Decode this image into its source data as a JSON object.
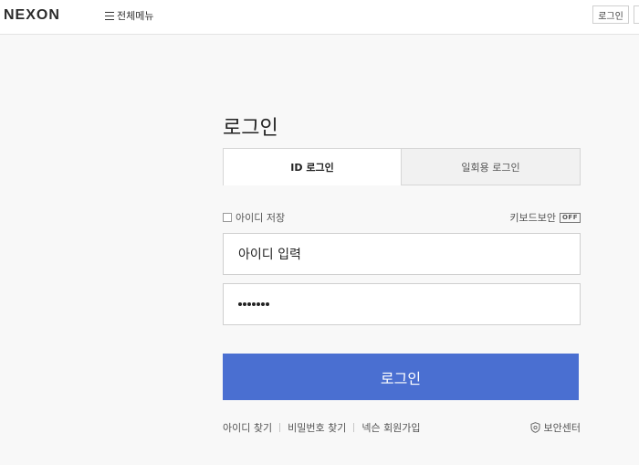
{
  "header": {
    "logo": "NEXON",
    "menu_label": "전체메뉴",
    "login_label": "로그인"
  },
  "login": {
    "title": "로그인",
    "tabs": [
      {
        "label": "ID 로그인",
        "active": true
      },
      {
        "label": "일회용 로그인",
        "active": false
      }
    ],
    "remember_label": "아이디 저장",
    "keyboard_label": "키보드보안",
    "keyboard_state": "OFF",
    "id_value": "아이디 입력",
    "password_length": 7,
    "submit_label": "로그인",
    "accent_color": "#4a6fd1"
  },
  "footer_links": {
    "find_id": "아이디 찾기",
    "find_password": "비밀번호 찾기",
    "signup": "넥슨 회원가입",
    "security_center": "보안센터"
  }
}
